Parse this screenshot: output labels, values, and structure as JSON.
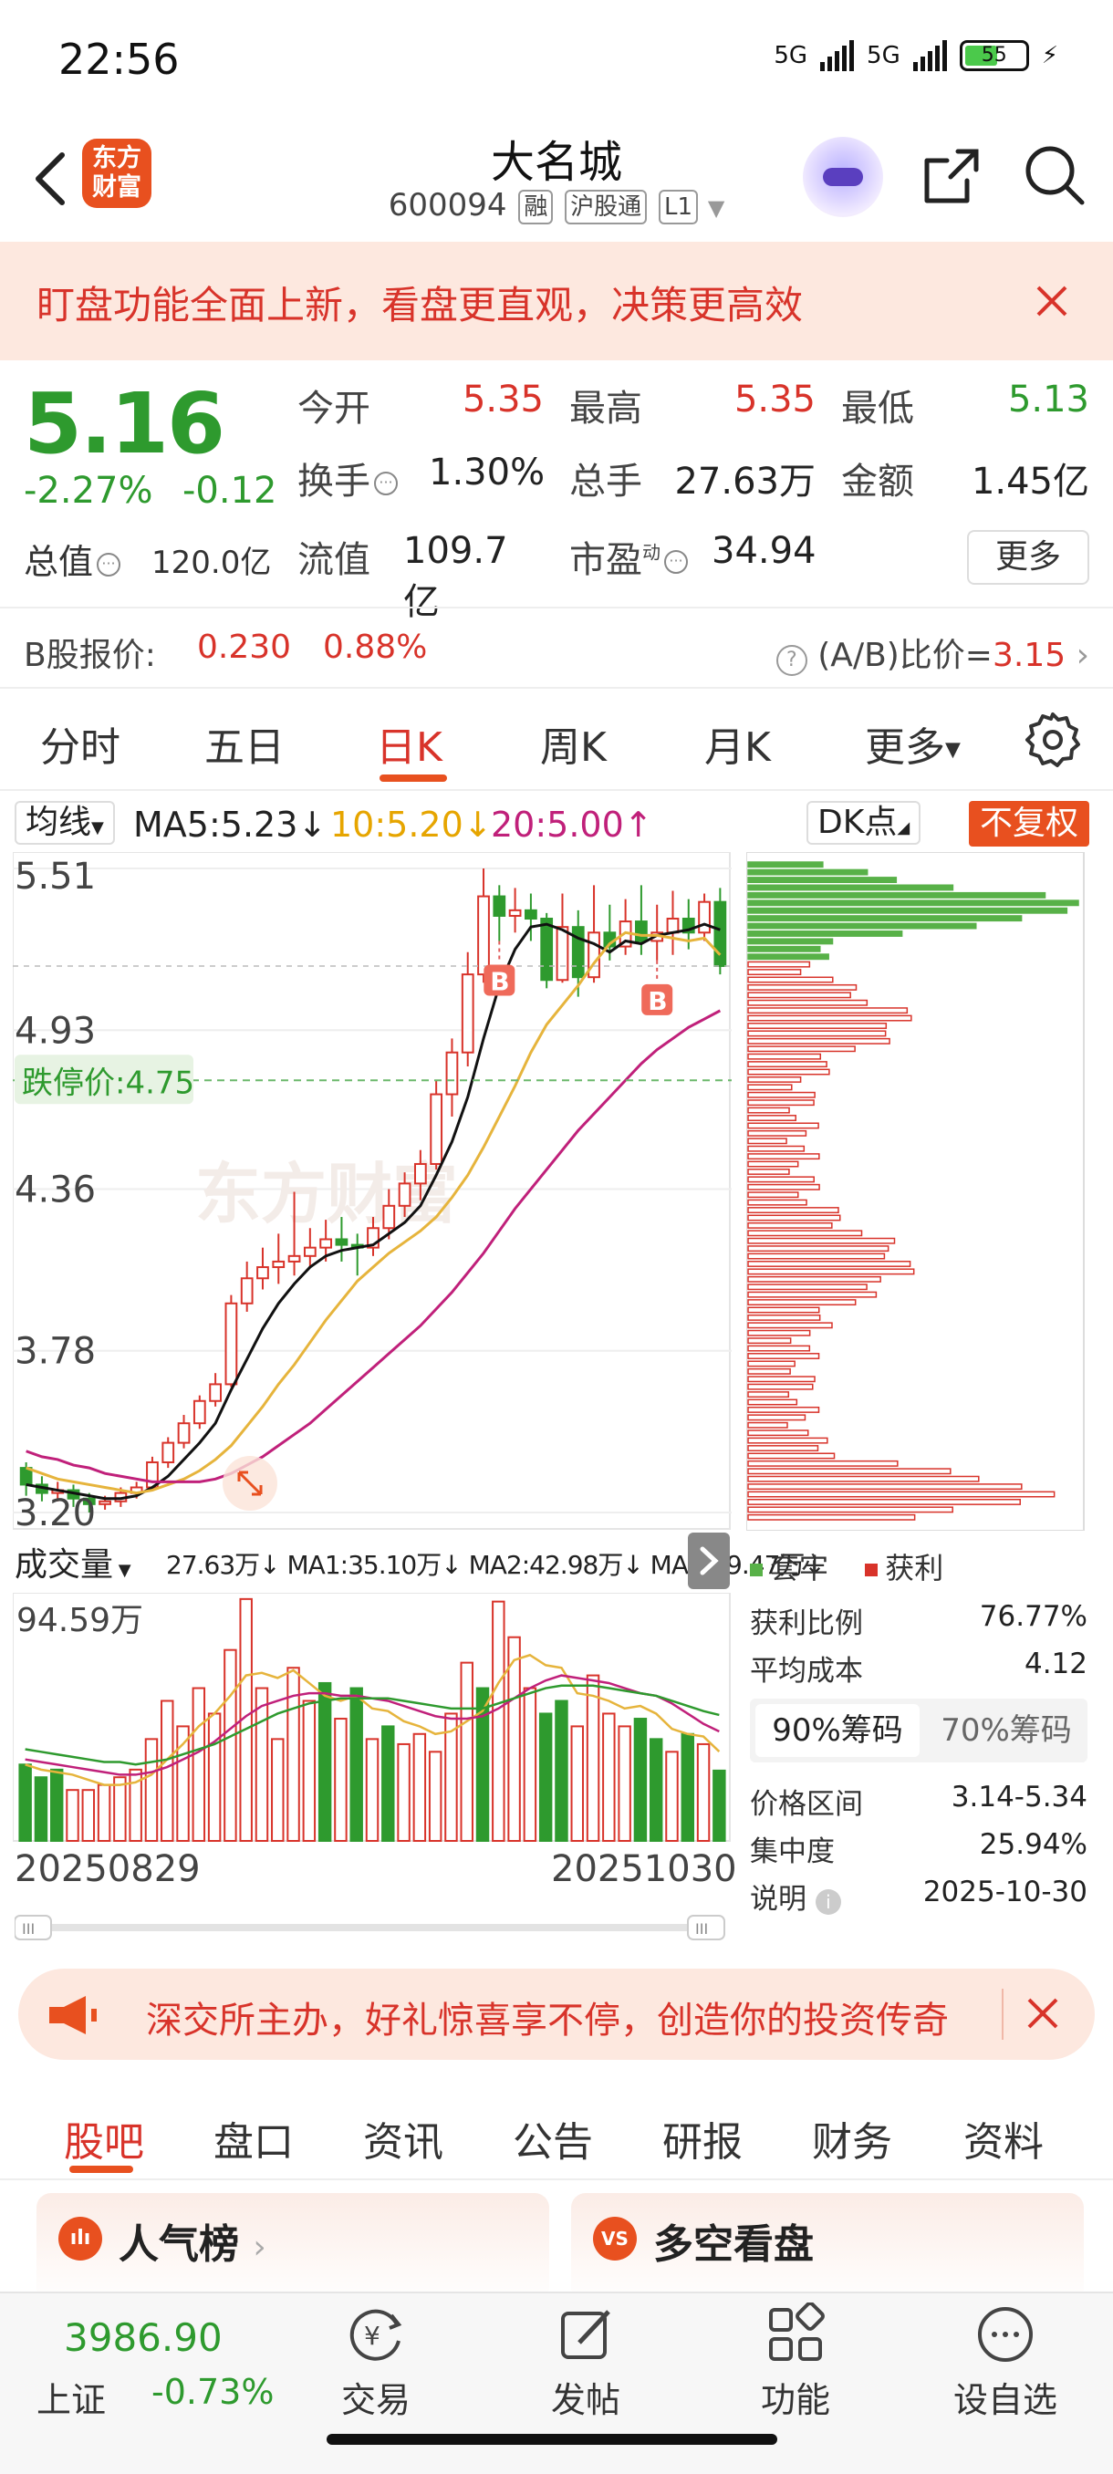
{
  "status": {
    "time": "22:56",
    "net1": "5G",
    "net2": "5G",
    "battery": "55"
  },
  "header": {
    "stock_name": "大名城",
    "code": "600094",
    "tags": [
      "融",
      "沪股通",
      "L1"
    ],
    "logo_text": "东方财富"
  },
  "banner": {
    "text": "盯盘功能全面上新，看盘更直观，决策更高效"
  },
  "quote": {
    "price": "5.16",
    "change_pct": "-2.27%",
    "change_amt": "-0.12",
    "total_mv_label": "总值",
    "total_mv": "120.0亿",
    "open_label": "今开",
    "open": "5.35",
    "high_label": "最高",
    "high": "5.35",
    "low_label": "最低",
    "low": "5.13",
    "turnover_label": "换手",
    "turnover": "1.30%",
    "volume_label": "总手",
    "volume": "27.63万",
    "amount_label": "金额",
    "amount": "1.45亿",
    "float_mv_label": "流值",
    "float_mv": "109.7亿",
    "pe_label": "市盈",
    "pe_sup": "动",
    "pe": "34.94",
    "more": "更多"
  },
  "bshare": {
    "label": "B股报价:",
    "price": "0.230",
    "pct": "0.88%",
    "ratio_label": "(A/B)比价=",
    "ratio": "3.15"
  },
  "period_tabs": [
    "分时",
    "五日",
    "日K",
    "周K",
    "月K",
    "更多"
  ],
  "ma_bar": {
    "select": "均线",
    "ma5": "MA5:5.23",
    "ma10": "10:5.20",
    "ma20": "20:5.00",
    "dk": "DK点",
    "fq": "不复权"
  },
  "kchart": {
    "price_ticks": [
      "5.51",
      "4.93",
      "4.36",
      "3.78",
      "3.20"
    ],
    "limit_down_label": "跌停价:4.75",
    "watermark": "东方财富",
    "marker": "B"
  },
  "volume": {
    "select": "成交量",
    "line": "27.63万↓ MA1:35.10万↓ MA2:42.98万↓ MA3:49.47万↓",
    "max_label": "94.59万",
    "date_start": "20250829",
    "date_end": "20251030"
  },
  "chips": {
    "legend_trapped": "套牢",
    "legend_profit": "获利",
    "profit_ratio_label": "获利比例",
    "profit_ratio": "76.77%",
    "avg_cost_label": "平均成本",
    "avg_cost": "4.12",
    "tab_90": "90%筹码",
    "tab_70": "70%筹码",
    "range_label": "价格区间",
    "range": "3.14-5.34",
    "concentration_label": "集中度",
    "concentration": "25.94%",
    "note_label": "说明",
    "note_date": "2025-10-30"
  },
  "promo": {
    "text": "深交所主办，好礼惊喜享不停，创造你的投资传奇"
  },
  "content_tabs": [
    "股吧",
    "盘口",
    "资讯",
    "公告",
    "研报",
    "财务",
    "资料"
  ],
  "cards": {
    "popular": "人气榜",
    "longshort": "多空看盘",
    "popular_icon": "ılı",
    "longshort_icon": "VS"
  },
  "bottom_nav": {
    "index_value": "3986.90",
    "index_name": "上证",
    "index_pct": "-0.73%",
    "items": [
      "交易",
      "发帖",
      "功能",
      "设自选"
    ]
  },
  "colors": {
    "up": "#d8332a",
    "down": "#2e9a2e",
    "accent": "#e8501f",
    "ma5": "#111111",
    "ma10": "#e6b43c",
    "ma20": "#c0207a"
  },
  "chart_data": [
    {
      "type": "candlestick",
      "title": "",
      "ylim": [
        3.2,
        5.51
      ],
      "x_range": [
        "20250829",
        "20251030"
      ],
      "candles": [
        [
          3.36,
          3.3,
          3.38,
          3.26
        ],
        [
          3.3,
          3.27,
          3.33,
          3.24
        ],
        [
          3.27,
          3.28,
          3.31,
          3.24
        ],
        [
          3.28,
          3.25,
          3.3,
          3.22
        ],
        [
          3.25,
          3.23,
          3.27,
          3.2
        ],
        [
          3.23,
          3.24,
          3.26,
          3.21
        ],
        [
          3.24,
          3.27,
          3.29,
          3.22
        ],
        [
          3.27,
          3.29,
          3.31,
          3.25
        ],
        [
          3.29,
          3.38,
          3.4,
          3.28
        ],
        [
          3.38,
          3.45,
          3.47,
          3.36
        ],
        [
          3.45,
          3.52,
          3.55,
          3.43
        ],
        [
          3.52,
          3.6,
          3.62,
          3.5
        ],
        [
          3.6,
          3.66,
          3.7,
          3.58
        ],
        [
          3.66,
          3.95,
          3.98,
          3.65
        ],
        [
          3.95,
          4.04,
          4.1,
          3.92
        ],
        [
          4.04,
          4.08,
          4.15,
          4.0
        ],
        [
          4.08,
          4.1,
          4.2,
          4.02
        ],
        [
          4.1,
          4.12,
          4.35,
          4.05
        ],
        [
          4.12,
          4.15,
          4.22,
          4.08
        ],
        [
          4.15,
          4.18,
          4.25,
          4.1
        ],
        [
          4.18,
          4.16,
          4.26,
          4.1
        ],
        [
          4.16,
          4.15,
          4.2,
          4.05
        ],
        [
          4.15,
          4.22,
          4.26,
          4.12
        ],
        [
          4.22,
          4.3,
          4.36,
          4.18
        ],
        [
          4.3,
          4.38,
          4.42,
          4.26
        ],
        [
          4.38,
          4.45,
          4.5,
          4.32
        ],
        [
          4.45,
          4.7,
          4.75,
          4.43
        ],
        [
          4.7,
          4.85,
          4.9,
          4.62
        ],
        [
          4.85,
          5.13,
          5.21,
          4.8
        ],
        [
          5.13,
          5.41,
          5.51,
          5.1
        ],
        [
          5.41,
          5.34,
          5.45,
          5.25
        ],
        [
          5.34,
          5.36,
          5.44,
          5.28
        ],
        [
          5.36,
          5.33,
          5.42,
          5.25
        ],
        [
          5.33,
          5.11,
          5.35,
          5.08
        ],
        [
          5.11,
          5.3,
          5.42,
          5.1
        ],
        [
          5.3,
          5.12,
          5.36,
          5.05
        ],
        [
          5.12,
          5.28,
          5.45,
          5.1
        ],
        [
          5.28,
          5.23,
          5.38,
          5.18
        ],
        [
          5.23,
          5.32,
          5.4,
          5.2
        ],
        [
          5.32,
          5.25,
          5.45,
          5.2
        ],
        [
          5.25,
          5.28,
          5.38,
          5.18
        ],
        [
          5.28,
          5.33,
          5.43,
          5.2
        ],
        [
          5.33,
          5.28,
          5.4,
          5.22
        ],
        [
          5.28,
          5.39,
          5.42,
          5.25
        ],
        [
          5.39,
          5.16,
          5.44,
          5.13
        ]
      ],
      "limit_down": 4.75,
      "ma5": [
        3.3,
        3.29,
        3.28,
        3.27,
        3.26,
        3.25,
        3.25,
        3.26,
        3.29,
        3.33,
        3.39,
        3.45,
        3.52,
        3.64,
        3.75,
        3.86,
        3.95,
        4.02,
        4.08,
        4.12,
        4.14,
        4.15,
        4.16,
        4.2,
        4.24,
        4.3,
        4.41,
        4.53,
        4.69,
        4.9,
        5.09,
        5.22,
        5.3,
        5.31,
        5.29,
        5.26,
        5.24,
        5.21,
        5.25,
        5.24,
        5.27,
        5.28,
        5.29,
        5.31,
        5.29
      ],
      "ma10": [
        3.36,
        3.34,
        3.32,
        3.31,
        3.3,
        3.29,
        3.28,
        3.27,
        3.28,
        3.3,
        3.32,
        3.35,
        3.39,
        3.44,
        3.51,
        3.58,
        3.66,
        3.73,
        3.81,
        3.89,
        3.96,
        4.03,
        4.08,
        4.13,
        4.17,
        4.21,
        4.26,
        4.33,
        4.41,
        4.51,
        4.62,
        4.73,
        4.85,
        4.95,
        5.02,
        5.09,
        5.17,
        5.24,
        5.28,
        5.27,
        5.27,
        5.26,
        5.25,
        5.26,
        5.2
      ],
      "ma20": [
        3.42,
        3.4,
        3.39,
        3.37,
        3.36,
        3.34,
        3.33,
        3.32,
        3.31,
        3.31,
        3.31,
        3.31,
        3.32,
        3.34,
        3.37,
        3.4,
        3.44,
        3.48,
        3.52,
        3.57,
        3.62,
        3.67,
        3.72,
        3.77,
        3.82,
        3.87,
        3.93,
        3.99,
        4.06,
        4.13,
        4.21,
        4.29,
        4.36,
        4.43,
        4.5,
        4.57,
        4.63,
        4.69,
        4.75,
        4.81,
        4.86,
        4.9,
        4.94,
        4.97,
        5.0
      ]
    },
    {
      "type": "bar",
      "title": "成交量",
      "ylim": [
        0,
        94.59
      ],
      "values": [
        30,
        25,
        28,
        20,
        20,
        22,
        25,
        28,
        40,
        55,
        45,
        60,
        50,
        75,
        95,
        60,
        40,
        68,
        55,
        62,
        48,
        60,
        40,
        45,
        38,
        42,
        35,
        50,
        70,
        60,
        94,
        80,
        60,
        50,
        55,
        45,
        65,
        50,
        45,
        48,
        40,
        35,
        42,
        38,
        27.63
      ],
      "down_flags": [
        1,
        1,
        1,
        0,
        0,
        0,
        0,
        0,
        0,
        0,
        0,
        0,
        0,
        0,
        0,
        0,
        0,
        0,
        0,
        1,
        0,
        1,
        0,
        1,
        0,
        0,
        0,
        0,
        0,
        1,
        0,
        0,
        0,
        1,
        1,
        0,
        0,
        0,
        0,
        1,
        1,
        0,
        1,
        0,
        1
      ],
      "ma1": [
        30,
        28,
        27,
        26,
        24,
        22,
        22,
        23,
        26,
        32,
        38,
        45,
        50,
        57,
        65,
        66,
        64,
        67,
        62,
        57,
        55,
        57,
        52,
        51,
        47,
        45,
        42,
        43,
        47,
        51,
        62,
        71,
        73,
        69,
        68,
        58,
        57,
        55,
        52,
        53,
        50,
        44,
        42,
        41,
        35.1
      ],
      "ma2": [
        32,
        31,
        30,
        29,
        28,
        27,
        26,
        26,
        27,
        29,
        32,
        35,
        39,
        44,
        49,
        53,
        55,
        57,
        58,
        58,
        57,
        57,
        56,
        55,
        53,
        51,
        49,
        48,
        48,
        49,
        52,
        56,
        60,
        63,
        65,
        64,
        63,
        62,
        60,
        58,
        57,
        54,
        50,
        46,
        42.98
      ],
      "ma3": [
        36,
        35,
        34,
        33,
        32,
        31,
        31,
        30,
        31,
        32,
        34,
        36,
        38,
        41,
        44,
        47,
        50,
        52,
        54,
        55,
        56,
        56,
        56,
        56,
        55,
        54,
        53,
        52,
        52,
        52,
        54,
        56,
        58,
        60,
        61,
        61,
        61,
        60,
        59,
        58,
        57,
        55,
        53,
        51,
        49.47
      ]
    }
  ]
}
